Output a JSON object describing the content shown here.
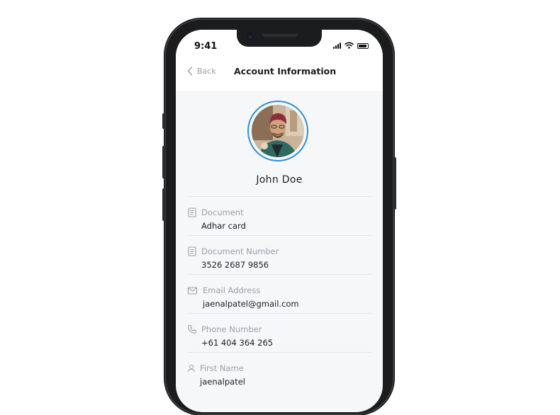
{
  "status_bar": {
    "time": "9:41"
  },
  "header": {
    "back_label": "Back",
    "title": "Account Information"
  },
  "profile": {
    "name": "John Doe"
  },
  "fields": [
    {
      "label": "Document",
      "value": "Adhar card",
      "icon": "document-icon"
    },
    {
      "label": "Document Number",
      "value": "3526 2687 9856",
      "icon": "document-icon"
    },
    {
      "label": "Email Address",
      "value": "jaenalpatel@gmail.com",
      "icon": "mail-icon"
    },
    {
      "label": "Phone Number",
      "value": "+61 404 364 265",
      "icon": "phone-icon"
    },
    {
      "label": "First Name",
      "value": "jaenalpatel",
      "icon": "user-icon"
    }
  ],
  "colors": {
    "accent": "#2f8fd8",
    "text": "#1c1d21",
    "muted": "#9aa0aa",
    "background": "#f6f7f9"
  }
}
